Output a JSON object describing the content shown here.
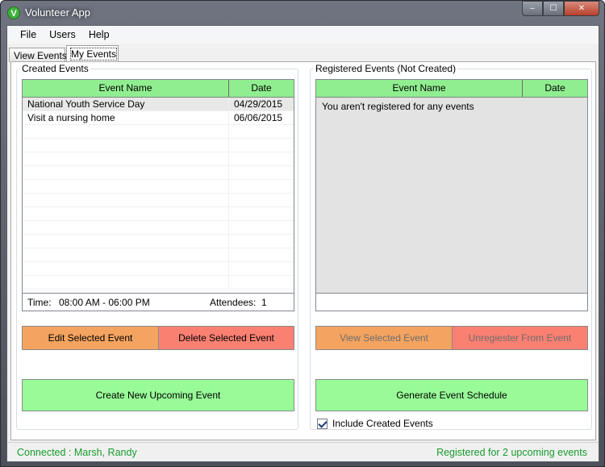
{
  "window": {
    "title": "Volunteer App",
    "icon": "V"
  },
  "window_controls": {
    "minimize": "‒",
    "maximize": "☐",
    "close": "✕"
  },
  "menu": [
    "File",
    "Users",
    "Help"
  ],
  "tabs": {
    "view_events": "View Events",
    "my_events": "My Events"
  },
  "created_events": {
    "group_label": "Created Events",
    "columns": [
      "Event Name",
      "Date"
    ],
    "rows": [
      {
        "name": "National Youth Service Day",
        "date": "04/29/2015"
      },
      {
        "name": "Visit a nursing home",
        "date": "06/06/2015"
      }
    ],
    "time_label": "Time:",
    "time_value": "08:00 AM - 06:00 PM",
    "attendees_label": "Attendees:",
    "attendees_value": "1",
    "edit_button": "Edit Selected Event",
    "delete_button": "Delete Selected Event",
    "create_button": "Create New Upcoming Event"
  },
  "registered_events": {
    "group_label": "Registered Events (Not Created)",
    "columns": [
      "Event Name",
      "Date"
    ],
    "empty_message": "You aren't registered for any events",
    "view_button": "View Selected Event",
    "unregister_button": "Unregiester From Event",
    "schedule_button": "Generate Event Schedule",
    "include_checkbox_label": "Include Created Events",
    "include_checked": true
  },
  "status": {
    "connected": "Connected : Marsh, Randy",
    "registered": "Registered for 2 upcoming events"
  },
  "colors": {
    "header_green": "#90ee90",
    "button_green": "#98fb98",
    "button_orange": "#f4a460",
    "button_red": "#fa8072",
    "status_text": "#179c2c"
  }
}
